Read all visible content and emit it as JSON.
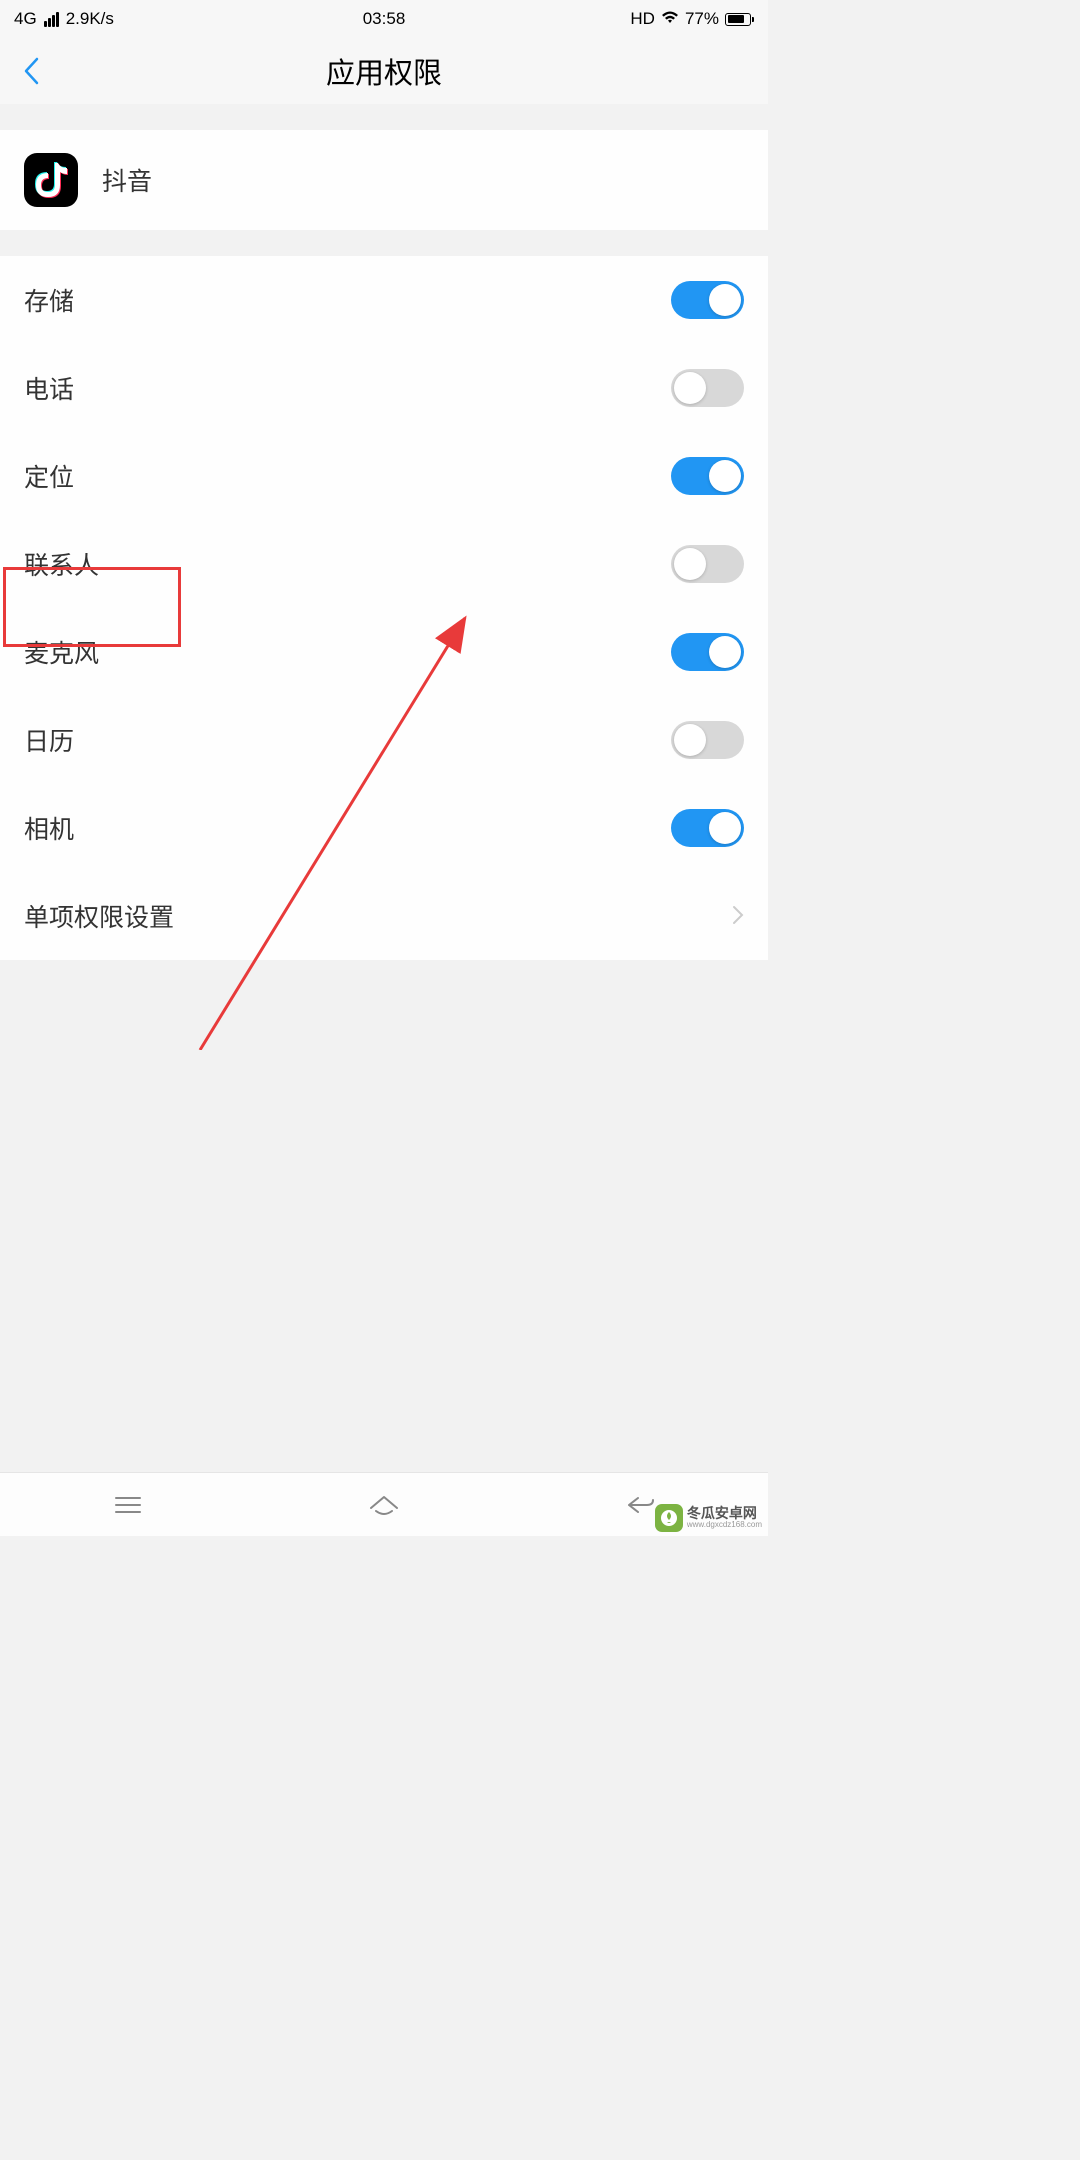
{
  "statusBar": {
    "network": "4G",
    "speed": "2.9K/s",
    "time": "03:58",
    "hd": "HD",
    "battery": "77%"
  },
  "header": {
    "title": "应用权限"
  },
  "app": {
    "name": "抖音"
  },
  "permissions": [
    {
      "label": "存储",
      "on": true
    },
    {
      "label": "电话",
      "on": false
    },
    {
      "label": "定位",
      "on": true
    },
    {
      "label": "联系人",
      "on": false
    },
    {
      "label": "麦克风",
      "on": true
    },
    {
      "label": "日历",
      "on": false
    },
    {
      "label": "相机",
      "on": true
    }
  ],
  "advanced": {
    "label": "单项权限设置"
  },
  "watermark": {
    "main": "冬瓜安卓网",
    "sub": "www.dgxcdz168.com"
  },
  "colors": {
    "accent": "#2196f3",
    "highlight": "#e83a3a"
  }
}
